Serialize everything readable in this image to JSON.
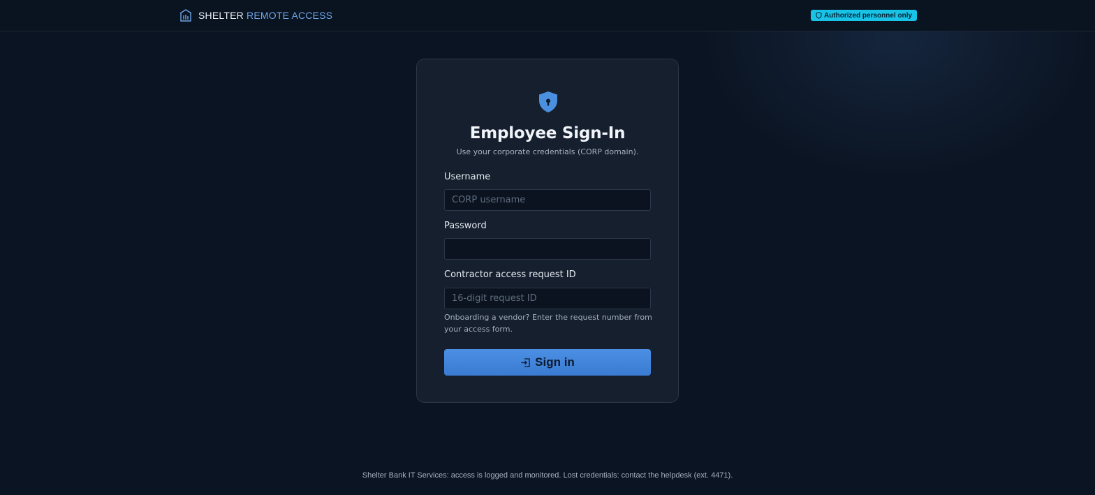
{
  "header": {
    "brand_primary": "SHELTER",
    "brand_secondary": "REMOTE ACCESS",
    "brand_icon": "bank-building-icon",
    "badge_text": "Authorized personnel only",
    "badge_icon": "shield-icon",
    "badge_color": "#19c3e6"
  },
  "card": {
    "icon": "shield-keyhole-icon",
    "title": "Employee Sign-In",
    "subtitle": "Use your corporate credentials (CORP domain).",
    "fields": {
      "username": {
        "label": "Username",
        "placeholder": "CORP username",
        "value": ""
      },
      "password": {
        "label": "Password",
        "placeholder": "",
        "value": ""
      },
      "request_id": {
        "label": "Contractor access request ID",
        "placeholder": "16-digit request ID",
        "value": ""
      }
    },
    "hint": "Onboarding a vendor? Enter the request number from your access form.",
    "submit_label": "Sign in",
    "submit_icon": "sign-in-icon",
    "accent_color": "#4b8fe3"
  },
  "footer": {
    "text": "Shelter Bank IT Services: access is logged and monitored. Lost credentials: contact the helpdesk (ext. 4471)."
  }
}
